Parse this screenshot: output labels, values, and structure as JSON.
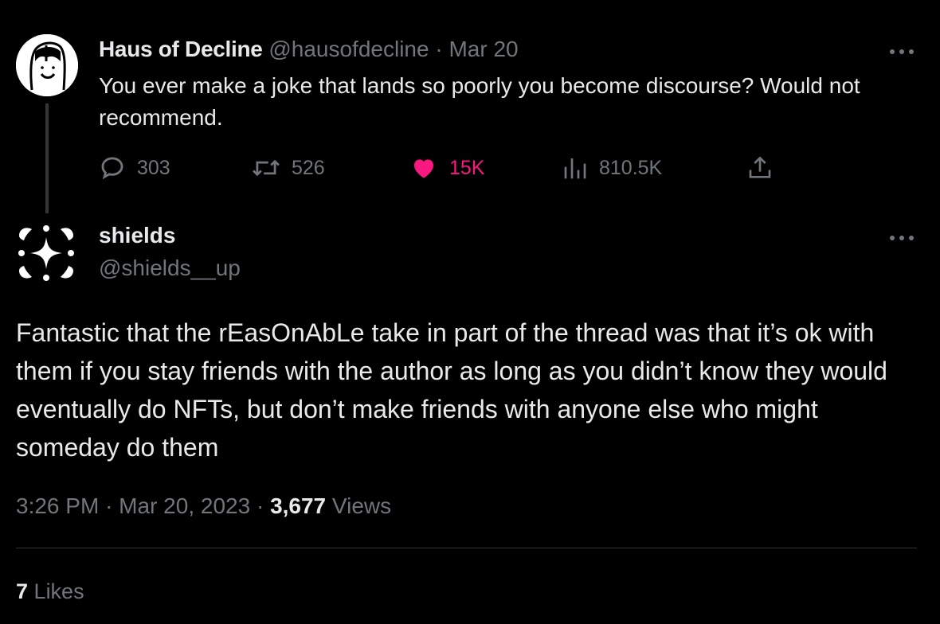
{
  "parent_tweet": {
    "display_name": "Haus of Decline",
    "handle": "@hausofdecline",
    "separator": "·",
    "date": "Mar 20",
    "text": "You ever make a joke that lands so poorly you become discourse? Would not recommend.",
    "more_icon": "ellipsis-icon",
    "actions": {
      "replies": "303",
      "retweets": "526",
      "likes": "15K",
      "views": "810.5K"
    },
    "like_color": "#f91880"
  },
  "main_tweet": {
    "display_name": "shields",
    "handle": "@shields__up",
    "more_icon": "ellipsis-icon",
    "text": "Fantastic that the rEasOnAbLe take in part of the thread was that it’s ok with them if you stay friends with the author as long as you didn’t know they would eventually do NFTs, but don’t make friends with anyone else who might someday do them",
    "time": "3:26 PM",
    "sep1": "·",
    "date": "Mar 20, 2023",
    "sep2": "·",
    "views_count": "3,677",
    "views_label": "Views",
    "likes_count": "7",
    "likes_label": "Likes"
  },
  "colors": {
    "background": "#000000",
    "primary_text": "#e7e9ea",
    "secondary_text": "#71767b",
    "divider": "#2f3336"
  }
}
